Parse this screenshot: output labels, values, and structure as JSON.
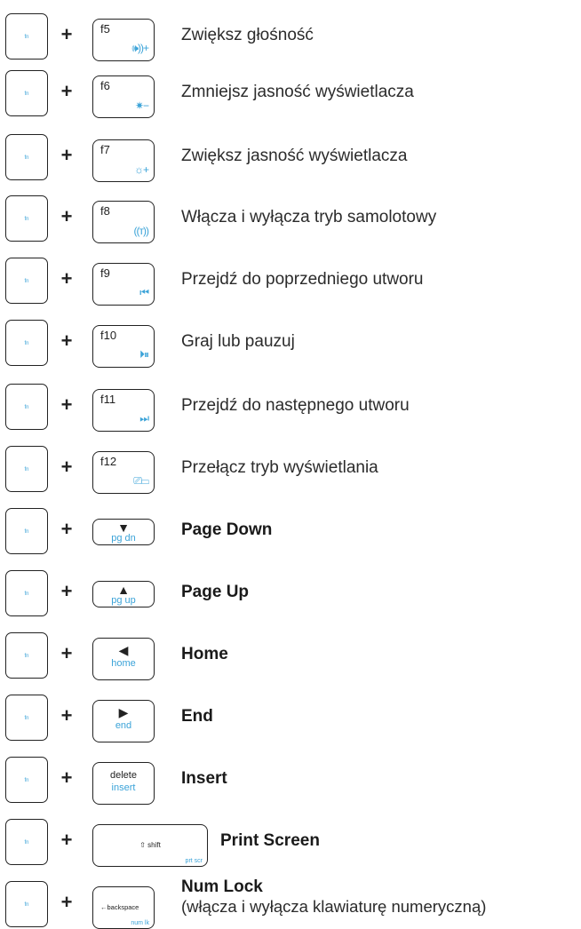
{
  "fn_label": "fn",
  "plus": "+",
  "accent_color": "#3ba3d8",
  "rows": [
    {
      "key_top": "f5",
      "key_icon": "🕪))+",
      "icon_name": "volume-up-icon",
      "desc": "Zwiększ głośność"
    },
    {
      "key_top": "f6",
      "key_icon": "✷−",
      "icon_name": "brightness-down-icon",
      "desc": "Zmniejsz jasność wyświetlacza"
    },
    {
      "key_top": "f7",
      "key_icon": "☼+",
      "icon_name": "brightness-up-icon",
      "desc": "Zwiększ jasność wyświetlacza"
    },
    {
      "key_top": "f8",
      "key_icon": "((ᴛ))",
      "icon_name": "airplane-mode-icon",
      "desc": "Włącza i wyłącza tryb samolotowy"
    },
    {
      "key_top": "f9",
      "key_icon": "⏮",
      "icon_name": "previous-track-icon",
      "desc": "Przejdź do poprzedniego utworu"
    },
    {
      "key_top": "f10",
      "key_icon": "⏵⏸",
      "icon_name": "play-pause-icon",
      "desc": "Graj lub pauzuj"
    },
    {
      "key_top": "f11",
      "key_icon": "⏭",
      "icon_name": "next-track-icon",
      "desc": "Przejdź do następnego utworu"
    },
    {
      "key_top": "f12",
      "key_icon": "⎚▭",
      "icon_name": "display-mode-icon",
      "desc": "Przełącz tryb wyświetlania"
    },
    {
      "arrow": "▼",
      "key_sub": "pg dn",
      "arrow_name": "down-arrow-icon",
      "desc": "Page Down"
    },
    {
      "arrow": "▲",
      "key_sub": "pg up",
      "arrow_name": "up-arrow-icon",
      "desc": "Page Up"
    },
    {
      "arrow": "◀",
      "key_sub": "home",
      "arrow_name": "left-arrow-icon",
      "desc": "Home"
    },
    {
      "arrow": "▶",
      "key_sub": "end",
      "arrow_name": "right-arrow-icon",
      "desc": "End"
    },
    {
      "key_main": "delete",
      "key_sub": "insert",
      "desc": "Insert"
    },
    {
      "key_main": "⇧ shift",
      "key_sub": "prt scr",
      "desc": "Print Screen"
    },
    {
      "key_main": "←backspace",
      "key_sub": "num lk",
      "desc": "Num Lock",
      "desc2": "(włącza i wyłącza klawiaturę numeryczną)"
    }
  ]
}
